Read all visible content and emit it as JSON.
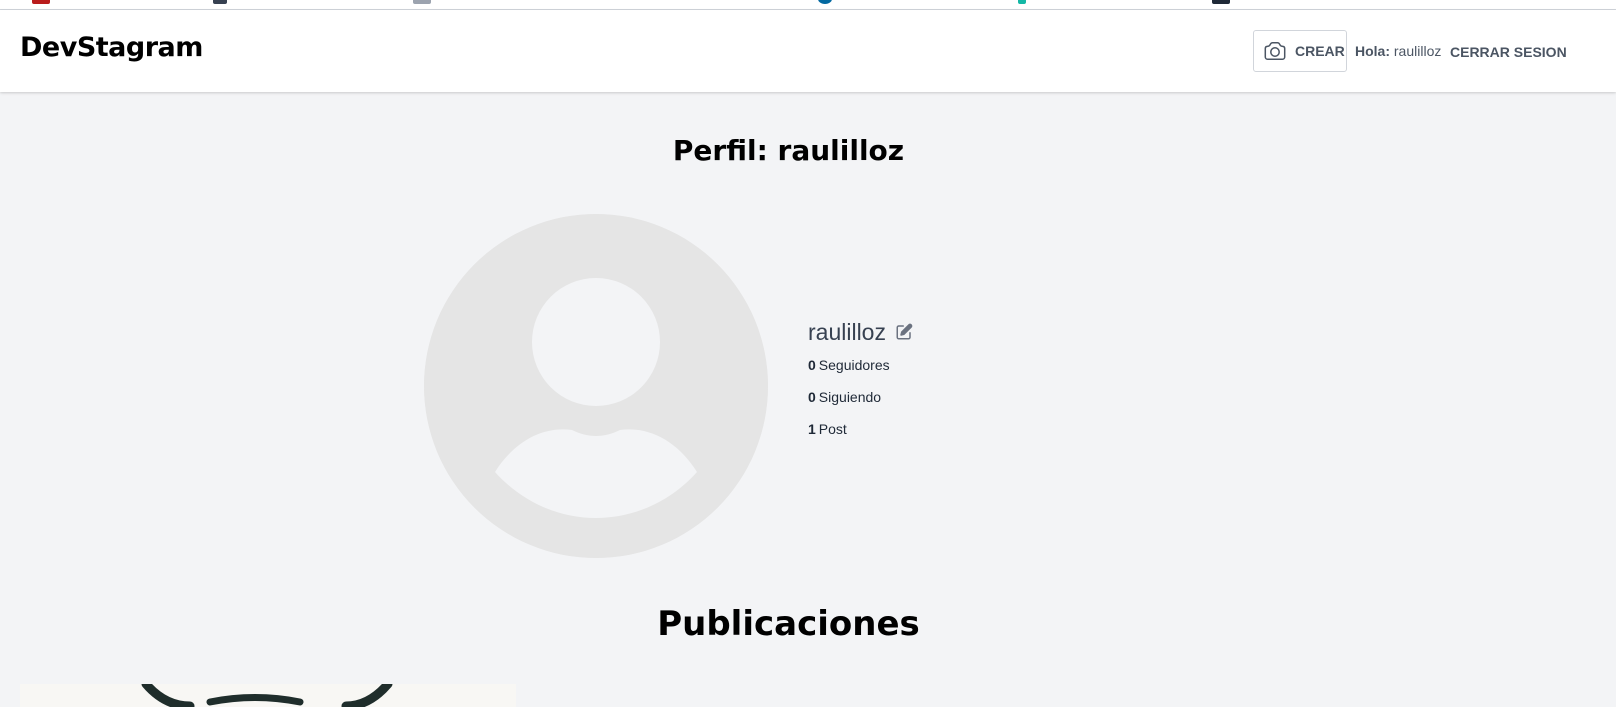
{
  "header": {
    "logo": "DevStagram",
    "create_label": "CREAR",
    "greeting_prefix": "Hola:",
    "greeting_user": "raulilloz",
    "logout_label": "CERRAR SESION"
  },
  "profile": {
    "title": "Perfil: raulilloz",
    "username": "raulilloz",
    "stats": {
      "followers_count": "0",
      "followers_label": "Seguidores",
      "following_count": "0",
      "following_label": "Siguiendo",
      "posts_count": "1",
      "posts_label": "Post"
    }
  },
  "posts": {
    "title": "Publicaciones"
  },
  "icons": {
    "create": "camera-icon",
    "edit_profile": "edit-icon",
    "avatar": "default-user-avatar"
  },
  "colors": {
    "page_bg": "#f3f4f6",
    "header_bg": "#ffffff",
    "avatar_bg": "#e5e5e5",
    "muted_text": "#4b5563"
  }
}
